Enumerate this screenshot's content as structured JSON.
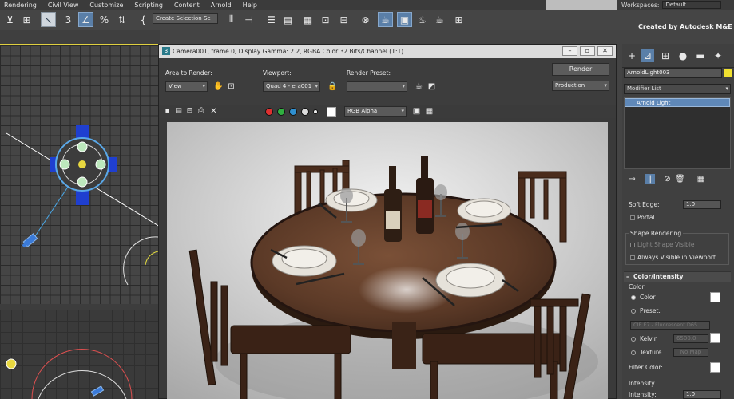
{
  "menu": [
    "Rendering",
    "Civil View",
    "Customize",
    "Scripting",
    "Content",
    "Arnold",
    "Help"
  ],
  "workspaces": {
    "label": "Workspaces:",
    "value": "Default"
  },
  "toolbar": {
    "selection_set": "Create Selection Se",
    "brand": "Created by Autodesk M&E"
  },
  "frame_window": {
    "title": "Camera001, frame 0, Display Gamma: 2.2, RGBA Color 32 Bits/Channel (1:1)",
    "area_label": "Area to Render:",
    "area_value": "View",
    "viewport_label": "Viewport:",
    "viewport_value": "Quad 4 - era001",
    "preset_label": "Render Preset:",
    "preset_value": "",
    "render_button": "Render",
    "production_value": "Production",
    "channel_value": "RGB Alpha"
  },
  "panel": {
    "object_name": "ArnoldLight003",
    "modifier_list": "Modifier List",
    "stack_item": "Arnold Light",
    "soft_edge_label": "Soft Edge:",
    "soft_edge_value": "1.0",
    "portal_label": "Portal",
    "shape_rendering_label": "Shape Rendering",
    "light_shape_visible": "Light Shape Visible",
    "always_visible": "Always Visible in Viewport",
    "color_intensity_header": "Color/Intensity",
    "color_group": "Color",
    "color_radio": "Color",
    "preset_label": "Preset:",
    "preset_value": "CIE F7 - Fluorescent D65",
    "kelvin_label": "Kelvin",
    "kelvin_value": "6500.0",
    "texture_label": "Texture",
    "no_map": "No Map",
    "filter_color_label": "Filter Color:",
    "intensity_group": "Intensity",
    "intensity_label": "Intensity:",
    "intensity_value": "1.0"
  },
  "colors": {
    "accent": "#5a7fa8",
    "viewport_border": "#d4c84a",
    "swatch": "#f0e030"
  },
  "icons": [
    "render-icon",
    "select-icon",
    "move-icon",
    "snap-icon",
    "percent-icon",
    "material-icon",
    "teapot-icon",
    "dot-red",
    "dot-green",
    "dot-blue"
  ]
}
